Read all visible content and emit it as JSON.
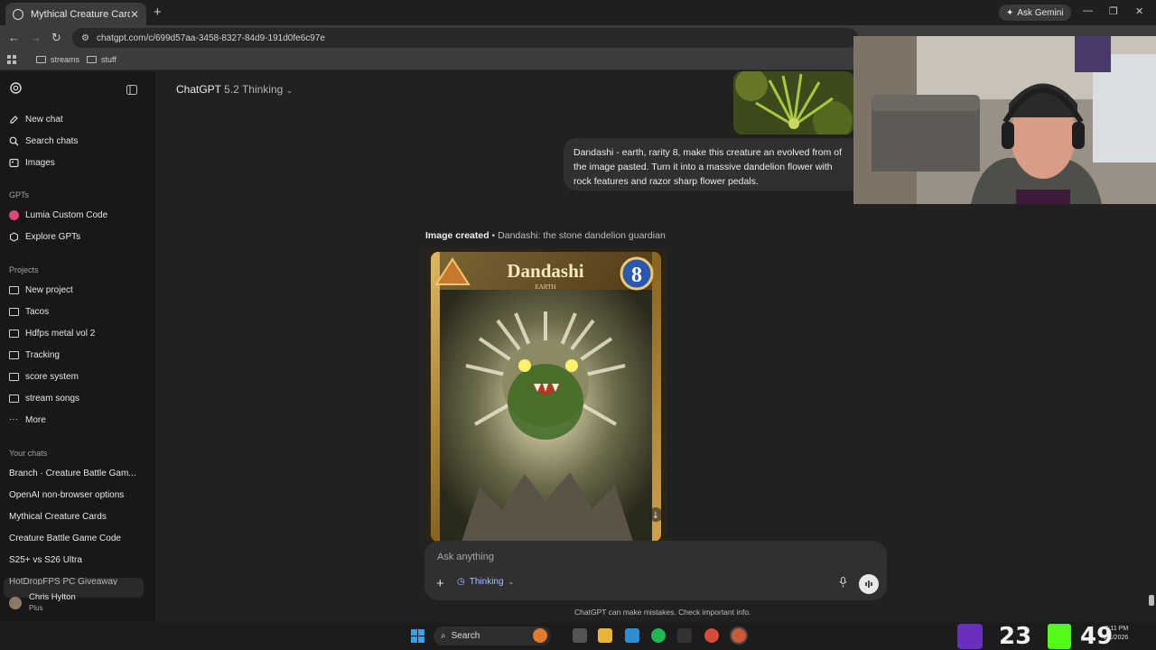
{
  "browser": {
    "tab_title": "Mythical Creature Cards",
    "new_tab": "+",
    "ask_gemini": "Ask Gemini",
    "url": "chatgpt.com/c/699d57aa-3458-8327-84d9-191d0fe6c97e",
    "bookmarks": [
      "streams",
      "stuff"
    ],
    "window_controls": [
      "—",
      "❐",
      "✕"
    ]
  },
  "sidebar": {
    "top_items": [
      {
        "label": "New chat",
        "icon": "edit-icon"
      },
      {
        "label": "Search chats",
        "icon": "search-icon"
      },
      {
        "label": "Images",
        "icon": "image-icon"
      }
    ],
    "gpts_header": "GPTs",
    "gpts": [
      {
        "label": "Lumia Custom Code",
        "icon": "lumia-icon"
      },
      {
        "label": "Explore GPTs",
        "icon": "explore-icon"
      }
    ],
    "projects_header": "Projects",
    "projects": [
      "New project",
      "Tacos",
      "Hdfps metal vol 2",
      "Tracking",
      "score system",
      "stream songs",
      "More"
    ],
    "chats_header": "Your chats",
    "chats": [
      "Branch · Creature Battle Gam...",
      "OpenAI non-browser options",
      "Mythical Creature Cards",
      "Creature Battle Game Code",
      "S25+ vs S26 Ultra",
      "HotDropFPS PC Giveaway"
    ],
    "user": {
      "name": "Chris Hylton",
      "plan": "Plus"
    }
  },
  "main": {
    "model_name": "ChatGPT",
    "model_version": "5.2 Thinking",
    "user_message": "Dandashi - earth, rarity 8, make this creature an evolved from of the image pasted. Turn it into a massive dandelion flower with rock features and razor sharp flower pedals.",
    "image_status": "Image created",
    "image_title": "• Dandashi: the stone dandelion guardian",
    "card": {
      "name": "Dandashi",
      "element": "EARTH",
      "rarity": "8"
    },
    "composer_placeholder": "Ask anything",
    "mode_label": "Thinking",
    "disclaimer": "ChatGPT can make mistakes. Check important info."
  },
  "taskbar": {
    "search_label": "Search",
    "stat_1": "23",
    "stat_2": "49",
    "time": "6:11 PM",
    "date": "2/1/2026"
  },
  "colors": {
    "background": "#212121",
    "sidebar": "#181818",
    "bubble": "#303030",
    "accent_blue": "#9ec4ff"
  }
}
